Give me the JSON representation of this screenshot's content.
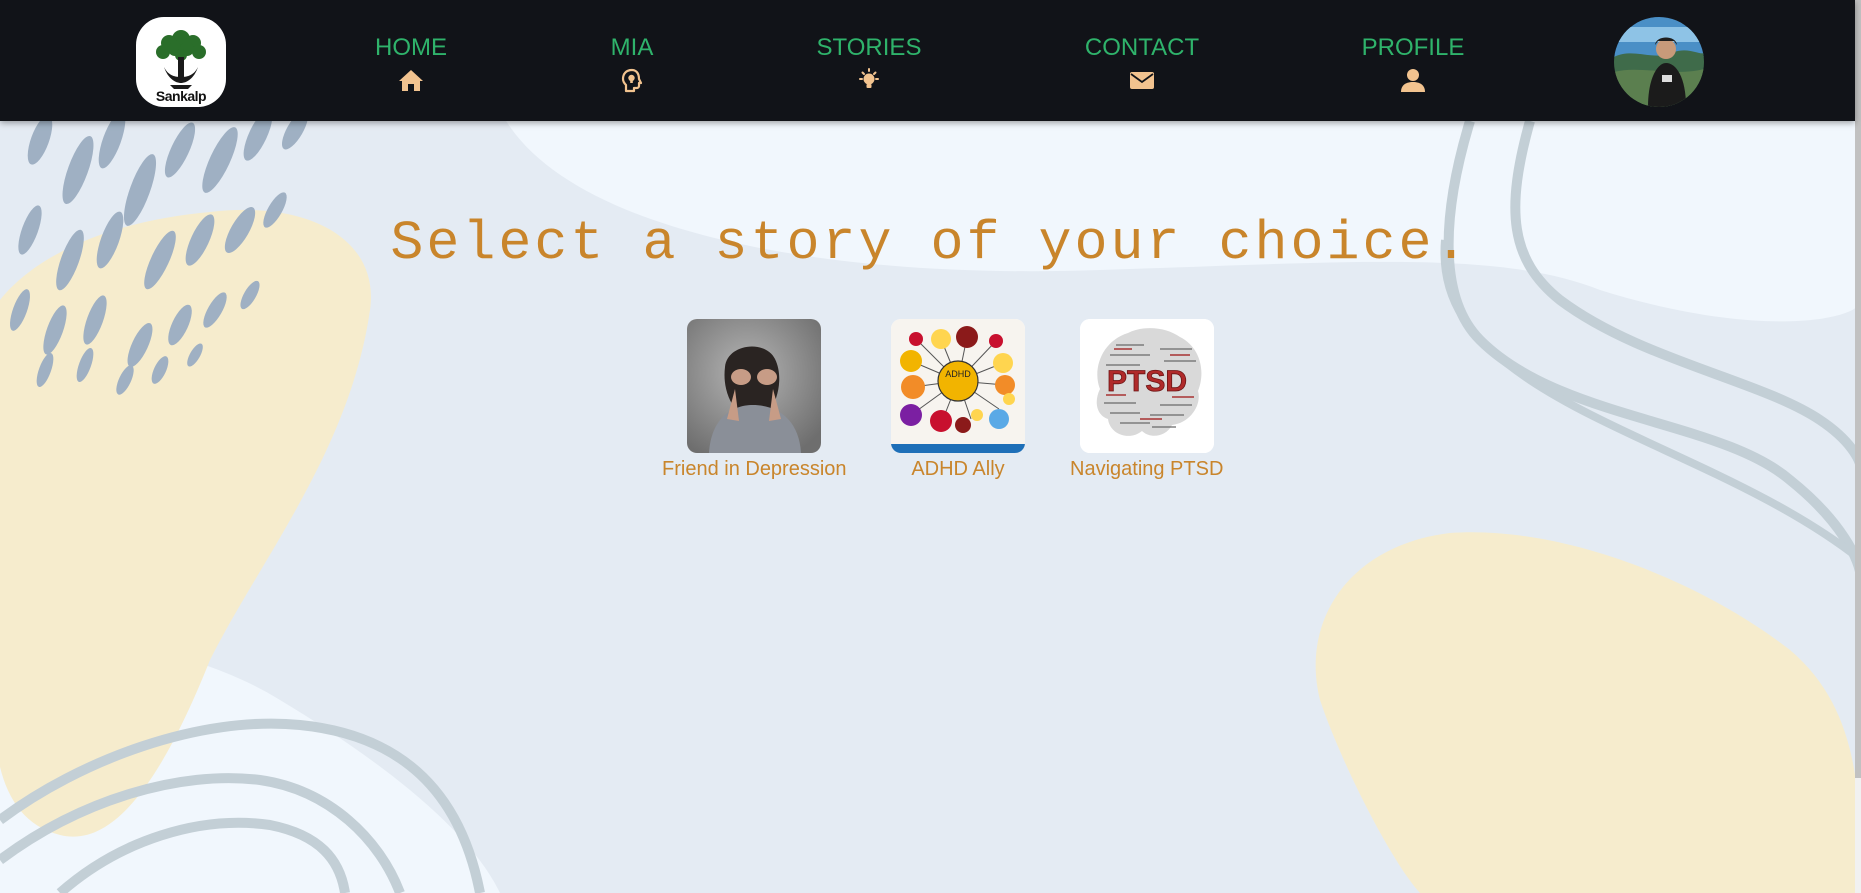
{
  "app": {
    "brand": "Sankalp"
  },
  "nav": {
    "items": [
      {
        "label": "HOME",
        "icon": "home-icon"
      },
      {
        "label": "MIA",
        "icon": "head-lightbulb-icon"
      },
      {
        "label": "STORIES",
        "icon": "lightbulb-icon"
      },
      {
        "label": "CONTACT",
        "icon": "envelope-icon"
      },
      {
        "label": "PROFILE",
        "icon": "user-icon"
      }
    ],
    "avatar": "profile-avatar"
  },
  "main": {
    "heading": "Select a story of your choice.",
    "stories": [
      {
        "label": "Friend in Depression",
        "image": "depressed-person-photo"
      },
      {
        "label": "ADHD Ally",
        "image": "adhd-mindmap-image"
      },
      {
        "label": "Navigating PTSD",
        "image": "ptsd-brain-wordcloud"
      }
    ]
  },
  "colors": {
    "navbar": "#111318",
    "nav_text": "#2fb36b",
    "accent": "#c9852b",
    "background": "#e4ebf3",
    "blob_yellow": "#f6eccd",
    "blob_light": "#f1f7fd",
    "drops": "#9fb0c3",
    "lines": "#c3cfd6"
  }
}
